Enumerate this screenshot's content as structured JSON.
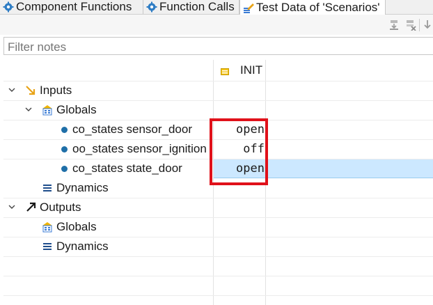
{
  "tabs": [
    {
      "label": "Component Functions",
      "icon": "gear-icon"
    },
    {
      "label": "Function Calls",
      "icon": "gear-icon"
    },
    {
      "label": "Test Data of 'Scenarios'",
      "icon": "edit-table-icon",
      "active": true
    }
  ],
  "toolbar": {
    "buttons": [
      "insert-below-icon",
      "delete-row-icon",
      "move-down-icon"
    ]
  },
  "filter": {
    "placeholder": "Filter notes",
    "value": ""
  },
  "columns": {
    "init_label": "INIT"
  },
  "tree": {
    "inputs": {
      "label": "Inputs",
      "expanded": true
    },
    "inputs_globals": {
      "label": "Globals",
      "expanded": true
    },
    "rows": [
      {
        "label": "co_states sensor_door",
        "value": "open"
      },
      {
        "label": "oo_states sensor_ignition",
        "value": "off"
      },
      {
        "label": "co_states state_door",
        "value": "open",
        "selected": true
      }
    ],
    "inputs_dynamics": {
      "label": "Dynamics"
    },
    "outputs": {
      "label": "Outputs",
      "expanded": true
    },
    "outputs_globals": {
      "label": "Globals"
    },
    "outputs_dynamics": {
      "label": "Dynamics"
    }
  },
  "colors": {
    "highlight": "#e0111a",
    "selection": "#cce8ff",
    "accent": "#1f6fa8"
  }
}
